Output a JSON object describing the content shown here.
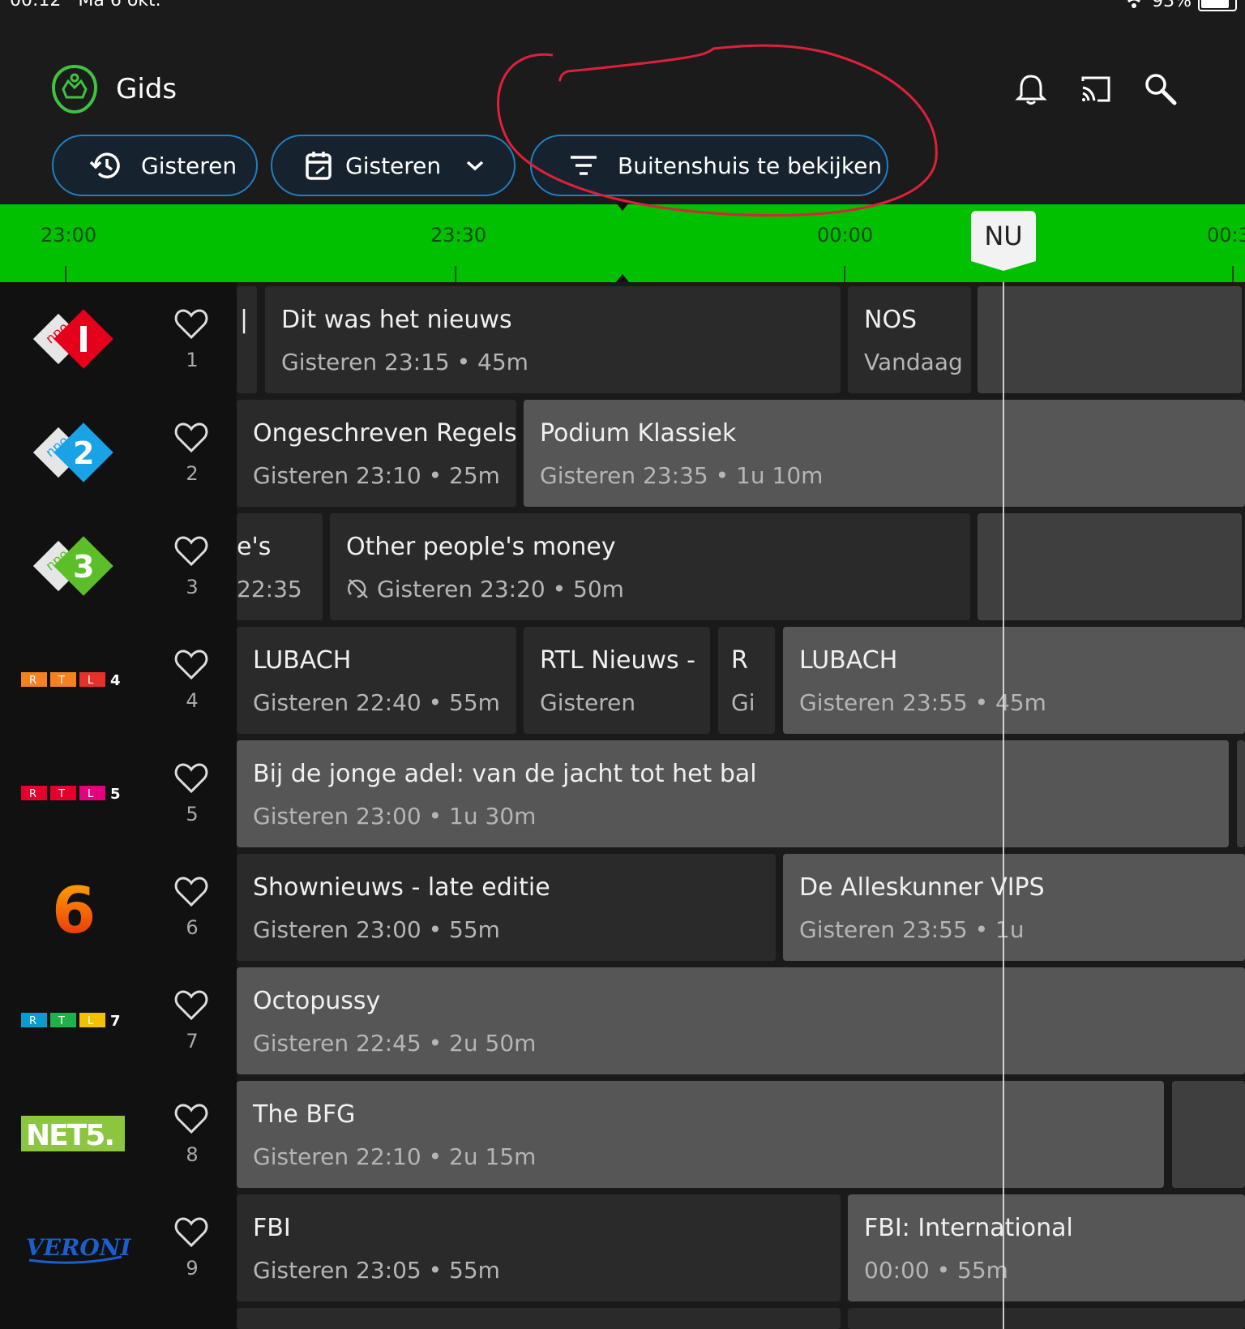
{
  "status_bar": {
    "time": "00:12",
    "date": "Ma 6 okt.",
    "battery": "93%"
  },
  "header": {
    "title": "Gids",
    "filters": {
      "history_label": "Gisteren",
      "date_label": "Gisteren",
      "outdoor_label": "Buitenshuis te bekijken"
    },
    "icons": [
      "bell-icon",
      "cast-icon",
      "search-icon"
    ]
  },
  "timeline": {
    "times": [
      "23:00",
      "23:30",
      "00:00",
      "00:3"
    ],
    "now_label": "NU"
  },
  "channels": [
    {
      "number": "1",
      "logo": "NPO 1"
    },
    {
      "number": "2",
      "logo": "NPO 2"
    },
    {
      "number": "3",
      "logo": "NPO 3"
    },
    {
      "number": "4",
      "logo": "RTL 4"
    },
    {
      "number": "5",
      "logo": "RTL 5"
    },
    {
      "number": "6",
      "logo": "6"
    },
    {
      "number": "7",
      "logo": "RTL 7"
    },
    {
      "number": "8",
      "logo": "NET5."
    },
    {
      "number": "9",
      "logo": "VERONICA"
    }
  ],
  "programs": {
    "r1": [
      {
        "title": "|",
        "sub": ""
      },
      {
        "title": "Dit was het nieuws",
        "sub": "Gisteren 23:15 • 45m"
      },
      {
        "title": "NOS",
        "sub": "Vandaag"
      }
    ],
    "r2": [
      {
        "title": "Ongeschreven Regels",
        "sub": "Gisteren 23:10 • 25m"
      },
      {
        "title": "Podium Klassiek",
        "sub": "Gisteren 23:35 • 1u 10m"
      }
    ],
    "r3": [
      {
        "title": "e's",
        "sub": "22:35"
      },
      {
        "title": "Other people's money",
        "sub": "Gisteren 23:20 • 50m"
      }
    ],
    "r4": [
      {
        "title": "LUBACH",
        "sub": "Gisteren 22:40 • 55m"
      },
      {
        "title": "RTL Nieuws -",
        "sub": "Gisteren"
      },
      {
        "title": "R",
        "sub": "Gi"
      },
      {
        "title": "LUBACH",
        "sub": "Gisteren 23:55 • 45m"
      }
    ],
    "r5": [
      {
        "title": "Bij de jonge adel: van de jacht tot het bal",
        "sub": "Gisteren 23:00 • 1u 30m"
      }
    ],
    "r6": [
      {
        "title": "Shownieuws - late editie",
        "sub": "Gisteren 23:00 • 55m"
      },
      {
        "title": "De Alleskunner VIPS",
        "sub": "Gisteren 23:55 • 1u"
      }
    ],
    "r7": [
      {
        "title": "Octopussy",
        "sub": "Gisteren 22:45 • 2u 50m"
      }
    ],
    "r8": [
      {
        "title": "The BFG",
        "sub": "Gisteren 22:10 • 2u 15m"
      }
    ],
    "r9": [
      {
        "title": "FBI",
        "sub": "Gisteren 23:05 • 55m"
      },
      {
        "title": "FBI: International",
        "sub": "00:00 • 55m"
      }
    ]
  },
  "colors": {
    "timeline": "#00c000",
    "chip_border": "#1f7fc2",
    "annotation": "#e0203a"
  }
}
